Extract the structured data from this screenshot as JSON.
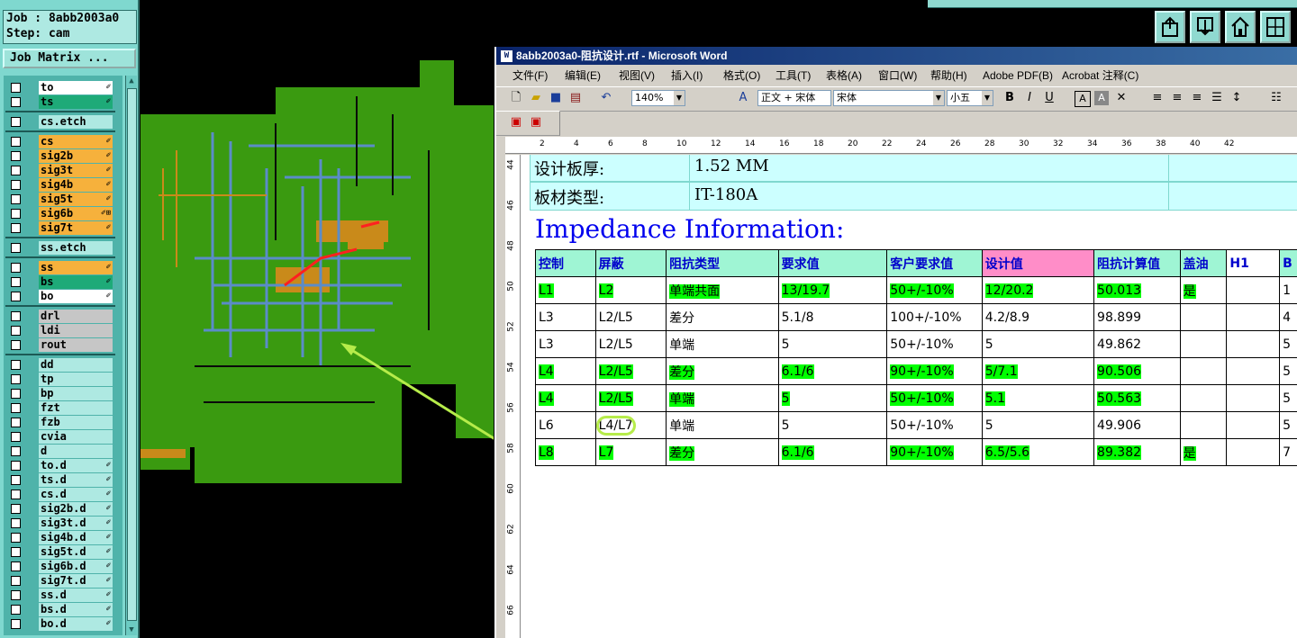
{
  "job_info": {
    "job": "Job : 8abb2003a0",
    "step": "Step: cam"
  },
  "job_matrix_label": "Job Matrix ...",
  "layers": [
    {
      "name": "to",
      "color": "#ffffff",
      "mark": "✐"
    },
    {
      "name": "ts",
      "color": "#1eaa78",
      "mark": "✐"
    },
    {
      "name": "cs.etch",
      "color": "#aee9e2",
      "mark": ""
    },
    {
      "name": "cs",
      "color": "#f6b13c",
      "mark": "✐"
    },
    {
      "name": "sig2b",
      "color": "#f6b13c",
      "mark": "✐"
    },
    {
      "name": "sig3t",
      "color": "#f6b13c",
      "mark": "✐"
    },
    {
      "name": "sig4b",
      "color": "#f6b13c",
      "mark": "✐"
    },
    {
      "name": "sig5t",
      "color": "#f6b13c",
      "mark": "✐"
    },
    {
      "name": "sig6b",
      "color": "#f6b13c",
      "mark": "✐⊞"
    },
    {
      "name": "sig7t",
      "color": "#f6b13c",
      "mark": "✐"
    },
    {
      "name": "ss.etch",
      "color": "#aee9e2",
      "mark": ""
    },
    {
      "name": "ss",
      "color": "#f6b13c",
      "mark": "✐"
    },
    {
      "name": "bs",
      "color": "#1eaa78",
      "mark": "✐"
    },
    {
      "name": "bo",
      "color": "#ffffff",
      "mark": "✐"
    },
    {
      "name": "drl",
      "color": "#c6c6c6",
      "mark": ""
    },
    {
      "name": "ldi",
      "color": "#c6c6c6",
      "mark": ""
    },
    {
      "name": "rout",
      "color": "#c6c6c6",
      "mark": ""
    },
    {
      "name": "dd",
      "color": "#aee9e2",
      "mark": ""
    },
    {
      "name": "tp",
      "color": "#aee9e2",
      "mark": ""
    },
    {
      "name": "bp",
      "color": "#aee9e2",
      "mark": ""
    },
    {
      "name": "fzt",
      "color": "#aee9e2",
      "mark": ""
    },
    {
      "name": "fzb",
      "color": "#aee9e2",
      "mark": ""
    },
    {
      "name": "cvia",
      "color": "#aee9e2",
      "mark": ""
    },
    {
      "name": "d",
      "color": "#aee9e2",
      "mark": ""
    },
    {
      "name": "to.d",
      "color": "#aee9e2",
      "mark": "✐"
    },
    {
      "name": "ts.d",
      "color": "#aee9e2",
      "mark": "✐"
    },
    {
      "name": "cs.d",
      "color": "#aee9e2",
      "mark": "✐"
    },
    {
      "name": "sig2b.d",
      "color": "#aee9e2",
      "mark": "✐"
    },
    {
      "name": "sig3t.d",
      "color": "#aee9e2",
      "mark": "✐"
    },
    {
      "name": "sig4b.d",
      "color": "#aee9e2",
      "mark": "✐"
    },
    {
      "name": "sig5t.d",
      "color": "#aee9e2",
      "mark": "✐"
    },
    {
      "name": "sig6b.d",
      "color": "#aee9e2",
      "mark": "✐"
    },
    {
      "name": "sig7t.d",
      "color": "#aee9e2",
      "mark": "✐"
    },
    {
      "name": "ss.d",
      "color": "#aee9e2",
      "mark": "✐"
    },
    {
      "name": "bs.d",
      "color": "#aee9e2",
      "mark": "✐"
    },
    {
      "name": "bo.d",
      "color": "#aee9e2",
      "mark": "✐"
    }
  ],
  "word": {
    "title": "8abb2003a0-阻抗设计.rtf - Microsoft Word",
    "menu": [
      "文件(F)",
      "编辑(E)",
      "视图(V)",
      "插入(I)",
      "格式(O)",
      "工具(T)",
      "表格(A)",
      "窗口(W)",
      "帮助(H)",
      "Adobe PDF(B)",
      "Acrobat 注释(C)"
    ],
    "zoom": "140%",
    "style": "正文 + 宋体",
    "font": "宋体",
    "font_size": "小五",
    "ruler_ticks": [
      "2",
      "4",
      "6",
      "8",
      "10",
      "12",
      "14",
      "16",
      "18",
      "20",
      "22",
      "24",
      "26",
      "28",
      "30",
      "32",
      "34",
      "36",
      "38",
      "40",
      "42"
    ],
    "vruler_ticks": [
      "44",
      "46",
      "48",
      "50",
      "52",
      "54",
      "56",
      "58",
      "60",
      "62",
      "64",
      "66"
    ],
    "info": [
      {
        "label": "设计板厚:",
        "value": "1.52 MM"
      },
      {
        "label": "板材类型:",
        "value": "IT-180A"
      }
    ],
    "heading": "Impedance Information:",
    "table_headers": [
      "控制",
      "屏蔽",
      "阻抗类型",
      "要求值",
      "客户要求值",
      "设计值",
      "阻抗计算值",
      "盖油",
      "H1",
      "B"
    ],
    "table_rows": [
      {
        "cells": [
          "L1",
          "L2",
          "单端共面",
          "13/19.7",
          "50+/-10%",
          "12/20.2",
          "50.013",
          "是",
          "",
          "1"
        ],
        "hl": true
      },
      {
        "cells": [
          "L3",
          "L2/L5",
          "差分",
          "5.1/8",
          "100+/-10%",
          "4.2/8.9",
          "98.899",
          "",
          "",
          "4"
        ],
        "hl": false
      },
      {
        "cells": [
          "L3",
          "L2/L5",
          "单端",
          "5",
          "50+/-10%",
          "5",
          "49.862",
          "",
          "",
          "5"
        ],
        "hl": false
      },
      {
        "cells": [
          "L4",
          "L2/L5",
          "差分",
          "6.1/6",
          "90+/-10%",
          "5/7.1",
          "90.506",
          "",
          "",
          "5"
        ],
        "hl": true
      },
      {
        "cells": [
          "L4",
          "L2/L5",
          "单端",
          "5",
          "50+/-10%",
          "5.1",
          "50.563",
          "",
          "",
          "5"
        ],
        "hl": true
      },
      {
        "cells": [
          "L6",
          "L4/L7",
          "单端",
          "5",
          "50+/-10%",
          "5",
          "49.906",
          "",
          "",
          "5"
        ],
        "hl": false
      },
      {
        "cells": [
          "L8",
          "L7",
          "差分",
          "6.1/6",
          "90+/-10%",
          "6.5/5.6",
          "89.382",
          "是",
          "",
          "7"
        ],
        "hl": true
      }
    ]
  },
  "colors": {
    "pcb_green": "#3a9a10",
    "highlight": "#00ff00",
    "title_blue": "#0a246a"
  }
}
